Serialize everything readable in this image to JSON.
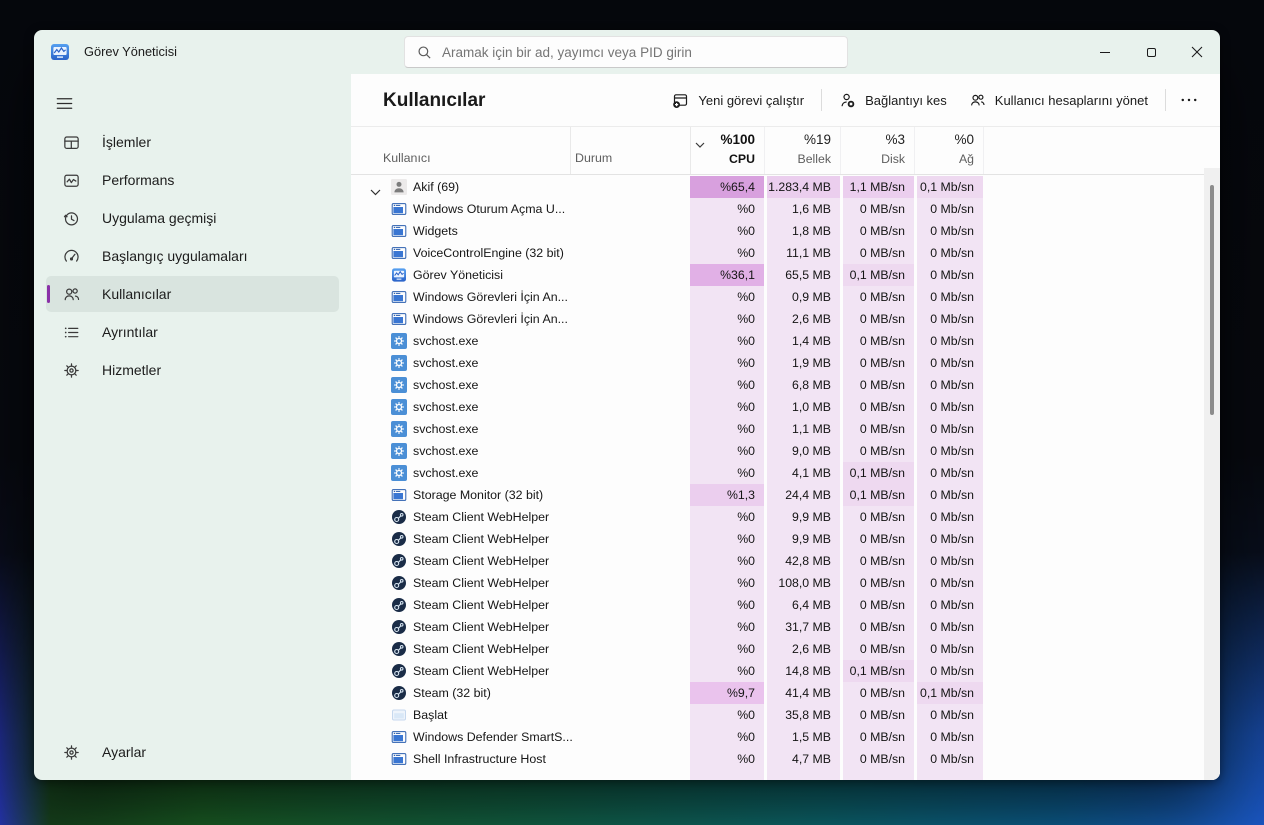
{
  "window": {
    "title": "Görev Yöneticisi"
  },
  "titlebar": {
    "search_placeholder": "Aramak için bir ad, yayımcı veya PID girin",
    "controls": [
      "minimize",
      "maximize",
      "close"
    ]
  },
  "colors": {
    "accent": "#8a31a8",
    "heat_scale": [
      "#f2e4f4",
      "#eed9f0",
      "#ebceee",
      "#eac3ed",
      "#e1b0e6",
      "#d8a0de"
    ],
    "sidebar_tint": "#e8f2ed"
  },
  "sidebar": {
    "items": [
      {
        "id": "islemler",
        "label": "İşlemler",
        "icon": "processes-icon",
        "selected": false
      },
      {
        "id": "performans",
        "label": "Performans",
        "icon": "performance-icon",
        "selected": false
      },
      {
        "id": "uygulama-gecmisi",
        "label": "Uygulama geçmişi",
        "icon": "app-history-icon",
        "selected": false
      },
      {
        "id": "baslangic-uygulamalari",
        "label": "Başlangıç uygulamaları",
        "icon": "startup-apps-icon",
        "selected": false
      },
      {
        "id": "kullanicilar",
        "label": "Kullanıcılar",
        "icon": "users-icon",
        "selected": true
      },
      {
        "id": "ayrintilar",
        "label": "Ayrıntılar",
        "icon": "details-icon",
        "selected": false
      },
      {
        "id": "hizmetler",
        "label": "Hizmetler",
        "icon": "services-icon",
        "selected": false
      }
    ],
    "settings_label": "Ayarlar",
    "settings_icon": "settings-gear-icon"
  },
  "page": {
    "title": "Kullanıcılar"
  },
  "toolbar": {
    "buttons": [
      {
        "id": "new-task",
        "label": "Yeni görevi çalıştır",
        "icon": "new-task-icon",
        "sep_before": false
      },
      {
        "id": "disconnect",
        "label": "Bağlantıyı kes",
        "icon": "disconnect-user-icon",
        "sep_before": true
      },
      {
        "id": "manage-accounts",
        "label": "Kullanıcı hesaplarını yönet",
        "icon": "manage-accounts-icon",
        "sep_before": false
      }
    ],
    "more_icon": "more-options-icon"
  },
  "table": {
    "columns": {
      "user": "Kullanıcı",
      "status": "Durum",
      "cpu": {
        "percent": "%100",
        "label": "CPU",
        "sorted": true
      },
      "memory": {
        "percent": "%19",
        "label": "Bellek",
        "sorted": false
      },
      "disk": {
        "percent": "%3",
        "label": "Disk",
        "sorted": false
      },
      "network": {
        "percent": "%0",
        "label": "Ağ",
        "sorted": false
      }
    },
    "rows": [
      {
        "name": "Akif (69)",
        "icon": "user-avatar-icon",
        "expandable": true,
        "expanded": true,
        "cpu": "%65,4",
        "mem": "1.283,4 MB",
        "disk": "1,1 MB/sn",
        "net": "0,1 Mb/sn",
        "heat": [
          5,
          2,
          2,
          1
        ]
      },
      {
        "name": "Windows Oturum Açma U...",
        "icon": "windows-app-icon",
        "cpu": "%0",
        "mem": "1,6 MB",
        "disk": "0 MB/sn",
        "net": "0 Mb/sn",
        "heat": [
          0,
          0,
          0,
          0
        ]
      },
      {
        "name": "Widgets",
        "icon": "windows-app-icon",
        "cpu": "%0",
        "mem": "1,8 MB",
        "disk": "0 MB/sn",
        "net": "0 Mb/sn",
        "heat": [
          0,
          0,
          0,
          0
        ]
      },
      {
        "name": "VoiceControlEngine (32 bit)",
        "icon": "windows-app-icon",
        "cpu": "%0",
        "mem": "11,1 MB",
        "disk": "0 MB/sn",
        "net": "0 Mb/sn",
        "heat": [
          0,
          0,
          0,
          0
        ]
      },
      {
        "name": "Görev Yöneticisi",
        "icon": "task-manager-icon",
        "cpu": "%36,1",
        "mem": "65,5 MB",
        "disk": "0,1 MB/sn",
        "net": "0 Mb/sn",
        "heat": [
          4,
          0,
          1,
          0
        ]
      },
      {
        "name": "Windows Görevleri İçin An...",
        "icon": "windows-app-icon",
        "cpu": "%0",
        "mem": "0,9 MB",
        "disk": "0 MB/sn",
        "net": "0 Mb/sn",
        "heat": [
          0,
          0,
          0,
          0
        ]
      },
      {
        "name": "Windows Görevleri İçin An...",
        "icon": "windows-app-icon",
        "cpu": "%0",
        "mem": "2,6 MB",
        "disk": "0 MB/sn",
        "net": "0 Mb/sn",
        "heat": [
          0,
          0,
          0,
          0
        ]
      },
      {
        "name": "svchost.exe",
        "icon": "service-gear-icon",
        "cpu": "%0",
        "mem": "1,4 MB",
        "disk": "0 MB/sn",
        "net": "0 Mb/sn",
        "heat": [
          0,
          0,
          0,
          0
        ]
      },
      {
        "name": "svchost.exe",
        "icon": "service-gear-icon",
        "cpu": "%0",
        "mem": "1,9 MB",
        "disk": "0 MB/sn",
        "net": "0 Mb/sn",
        "heat": [
          0,
          0,
          0,
          0
        ]
      },
      {
        "name": "svchost.exe",
        "icon": "service-gear-icon",
        "cpu": "%0",
        "mem": "6,8 MB",
        "disk": "0 MB/sn",
        "net": "0 Mb/sn",
        "heat": [
          0,
          0,
          0,
          0
        ]
      },
      {
        "name": "svchost.exe",
        "icon": "service-gear-icon",
        "cpu": "%0",
        "mem": "1,0 MB",
        "disk": "0 MB/sn",
        "net": "0 Mb/sn",
        "heat": [
          0,
          0,
          0,
          0
        ]
      },
      {
        "name": "svchost.exe",
        "icon": "service-gear-icon",
        "cpu": "%0",
        "mem": "1,1 MB",
        "disk": "0 MB/sn",
        "net": "0 Mb/sn",
        "heat": [
          0,
          0,
          0,
          0
        ]
      },
      {
        "name": "svchost.exe",
        "icon": "service-gear-icon",
        "cpu": "%0",
        "mem": "9,0 MB",
        "disk": "0 MB/sn",
        "net": "0 Mb/sn",
        "heat": [
          0,
          0,
          0,
          0
        ]
      },
      {
        "name": "svchost.exe",
        "icon": "service-gear-icon",
        "cpu": "%0",
        "mem": "4,1 MB",
        "disk": "0,1 MB/sn",
        "net": "0 Mb/sn",
        "heat": [
          0,
          0,
          1,
          0
        ]
      },
      {
        "name": "Storage Monitor (32 bit)",
        "icon": "windows-app-icon",
        "cpu": "%1,3",
        "mem": "24,4 MB",
        "disk": "0,1 MB/sn",
        "net": "0 Mb/sn",
        "heat": [
          2,
          0,
          1,
          0
        ]
      },
      {
        "name": "Steam Client WebHelper",
        "icon": "steam-icon",
        "cpu": "%0",
        "mem": "9,9 MB",
        "disk": "0 MB/sn",
        "net": "0 Mb/sn",
        "heat": [
          0,
          0,
          0,
          0
        ]
      },
      {
        "name": "Steam Client WebHelper",
        "icon": "steam-icon",
        "cpu": "%0",
        "mem": "9,9 MB",
        "disk": "0 MB/sn",
        "net": "0 Mb/sn",
        "heat": [
          0,
          0,
          0,
          0
        ]
      },
      {
        "name": "Steam Client WebHelper",
        "icon": "steam-icon",
        "cpu": "%0",
        "mem": "42,8 MB",
        "disk": "0 MB/sn",
        "net": "0 Mb/sn",
        "heat": [
          0,
          0,
          0,
          0
        ]
      },
      {
        "name": "Steam Client WebHelper",
        "icon": "steam-icon",
        "cpu": "%0",
        "mem": "108,0 MB",
        "disk": "0 MB/sn",
        "net": "0 Mb/sn",
        "heat": [
          0,
          0,
          0,
          0
        ]
      },
      {
        "name": "Steam Client WebHelper",
        "icon": "steam-icon",
        "cpu": "%0",
        "mem": "6,4 MB",
        "disk": "0 MB/sn",
        "net": "0 Mb/sn",
        "heat": [
          0,
          0,
          0,
          0
        ]
      },
      {
        "name": "Steam Client WebHelper",
        "icon": "steam-icon",
        "cpu": "%0",
        "mem": "31,7 MB",
        "disk": "0 MB/sn",
        "net": "0 Mb/sn",
        "heat": [
          0,
          0,
          0,
          0
        ]
      },
      {
        "name": "Steam Client WebHelper",
        "icon": "steam-icon",
        "cpu": "%0",
        "mem": "2,6 MB",
        "disk": "0 MB/sn",
        "net": "0 Mb/sn",
        "heat": [
          0,
          0,
          0,
          0
        ]
      },
      {
        "name": "Steam Client WebHelper",
        "icon": "steam-icon",
        "cpu": "%0",
        "mem": "14,8 MB",
        "disk": "0,1 MB/sn",
        "net": "0 Mb/sn",
        "heat": [
          0,
          0,
          1,
          0
        ]
      },
      {
        "name": "Steam (32 bit)",
        "icon": "steam-icon",
        "cpu": "%9,7",
        "mem": "41,4 MB",
        "disk": "0 MB/sn",
        "net": "0,1 Mb/sn",
        "heat": [
          3,
          0,
          0,
          1
        ]
      },
      {
        "name": "Başlat",
        "icon": "start-menu-icon",
        "cpu": "%0",
        "mem": "35,8 MB",
        "disk": "0 MB/sn",
        "net": "0 Mb/sn",
        "heat": [
          0,
          0,
          0,
          0
        ]
      },
      {
        "name": "Windows Defender SmartS...",
        "icon": "windows-app-icon",
        "cpu": "%0",
        "mem": "1,5 MB",
        "disk": "0 MB/sn",
        "net": "0 Mb/sn",
        "heat": [
          0,
          0,
          0,
          0
        ]
      },
      {
        "name": "Shell Infrastructure Host",
        "icon": "windows-app-icon",
        "cpu": "%0",
        "mem": "4,7 MB",
        "disk": "0 MB/sn",
        "net": "0 Mb/sn",
        "heat": [
          0,
          0,
          0,
          0
        ]
      },
      {
        "name": "",
        "icon": null,
        "partial": true,
        "cpu": "",
        "mem": "",
        "disk": "",
        "net": "",
        "heat": [
          0,
          0,
          0,
          0
        ]
      }
    ]
  }
}
